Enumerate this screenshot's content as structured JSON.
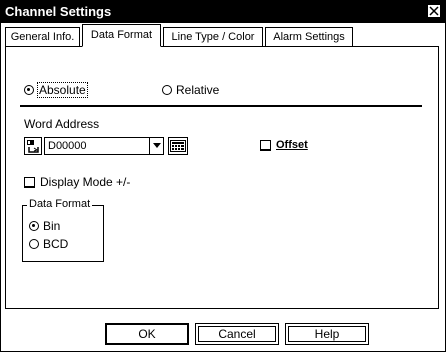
{
  "window": {
    "title": "Channel Settings",
    "close_glyph": "⊠"
  },
  "tabs": [
    {
      "label": "General Info.",
      "active": false
    },
    {
      "label": "Data Format",
      "active": true
    },
    {
      "label": "Line Type / Color",
      "active": false
    },
    {
      "label": "Alarm Settings",
      "active": false
    }
  ],
  "address_mode": {
    "absolute_label": "Absolute",
    "relative_label": "Relative",
    "selected": "Absolute"
  },
  "word_address": {
    "label": "Word Address",
    "value": "D00000"
  },
  "offset": {
    "label": "Offset",
    "checked": false
  },
  "display_mode": {
    "label": "Display Mode +/-",
    "checked": false
  },
  "data_format": {
    "title": "Data Format",
    "options": [
      "Bin",
      "BCD"
    ],
    "selected": "Bin"
  },
  "buttons": {
    "ok": "OK",
    "cancel": "Cancel",
    "help": "Help"
  },
  "colors": {
    "foreground": "#000000",
    "background": "#ffffff"
  }
}
